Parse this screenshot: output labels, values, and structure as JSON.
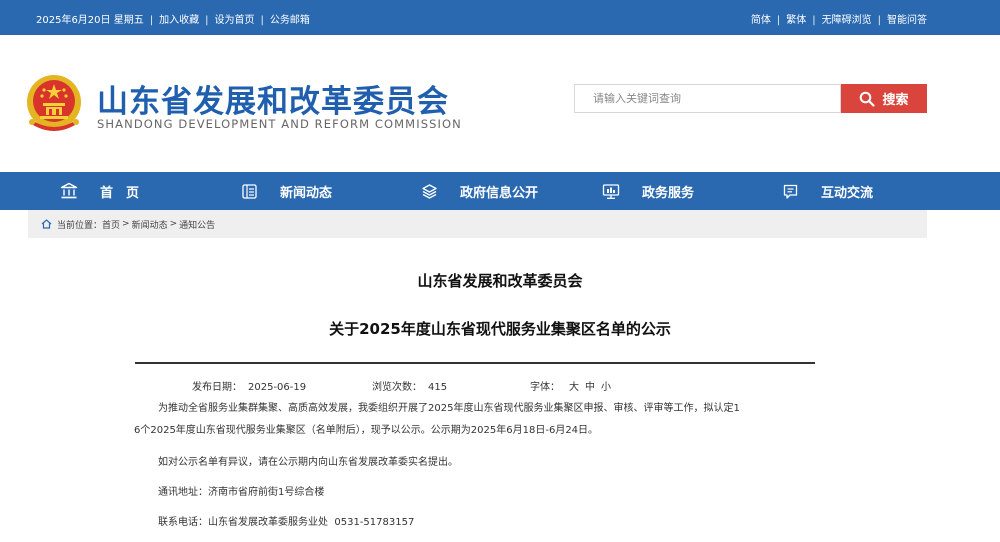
{
  "topbar": {
    "date": "2025年6月20日 星期五",
    "add_favorite": "加入收藏",
    "set_home": "设为首页",
    "mail": "公务邮箱",
    "simplified": "简体",
    "traditional": "繁体",
    "accessible": "无障碍浏览",
    "smart_qa": "智能问答"
  },
  "header": {
    "title": "山东省发展和改革委员会",
    "subtitle": "SHANDONG DEVELOPMENT AND REFORM COMMISSION"
  },
  "search": {
    "placeholder": "请输入关键词查询",
    "button_label": "搜索"
  },
  "nav": {
    "items": [
      {
        "label": "首　页",
        "icon": "bank-icon"
      },
      {
        "label": "新闻动态",
        "icon": "news-icon"
      },
      {
        "label": "政府信息公开",
        "icon": "layers-icon"
      },
      {
        "label": "政务服务",
        "icon": "monitor-icon"
      },
      {
        "label": "互动交流",
        "icon": "chat-icon"
      }
    ]
  },
  "breadcrumb": {
    "prefix": "当前位置：",
    "home": "首页",
    "news": "新闻动态",
    "notice": "通知公告",
    "sep": ">"
  },
  "article": {
    "org": "山东省发展和改革委员会",
    "title": "关于2025年度山东省现代服务业集聚区名单的公示",
    "date_label": "发布日期：",
    "date": "2025-06-19",
    "views_label": "浏览次数：",
    "views": "415",
    "font_label": "字体：",
    "font_large": "大",
    "font_medium": "中",
    "font_small": "小",
    "p1_line1": "为推动全省服务业集群集聚、高质高效发展，我委组织开展了2025年度山东省现代服务业集聚区申报、审核、评审等工作，拟认定1",
    "p1_line2": "6个2025年度山东省现代服务业集聚区（名单附后），现予以公示。公示期为2025年6月18日-6月24日。",
    "p2": "如对公示名单有异议，请在公示期内向山东省发展改革委实名提出。",
    "p3": "通讯地址：济南市省府前街1号综合楼",
    "p4": "联系电话：山东省发展改革委服务业处  0531-51783157"
  },
  "colors": {
    "brand_blue": "#2a69b0",
    "title_blue": "#1f5fae",
    "search_red": "#d9453c"
  }
}
